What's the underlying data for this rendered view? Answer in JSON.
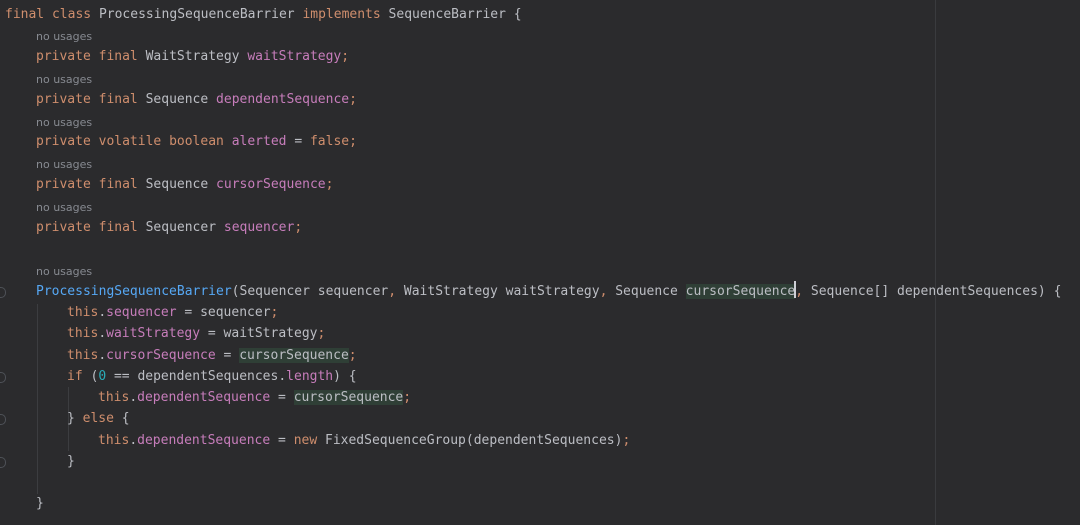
{
  "editor": {
    "colors": {
      "background": "#2b2b2d",
      "keyword": "#cf8e6d",
      "field": "#c77dbb",
      "method": "#56a8f5",
      "number": "#2aacb8",
      "text": "#bcbec4",
      "hint": "#878a91",
      "highlight": "#2f3f36"
    },
    "usage_hint": "no usages",
    "lines": {
      "class_decl": {
        "kw1": "final",
        "kw2": "class",
        "name": "ProcessingSequenceBarrier",
        "kw3": "implements",
        "iface": "SequenceBarrier",
        "brace": "{"
      },
      "field1": {
        "kw1": "private",
        "kw2": "final",
        "type": "WaitStrategy",
        "name": "waitStrategy"
      },
      "field2": {
        "kw1": "private",
        "kw2": "final",
        "type": "Sequence",
        "name": "dependentSequence"
      },
      "field3": {
        "kw1": "private",
        "kw2": "volatile",
        "kw3": "boolean",
        "name": "alerted",
        "op": "=",
        "value": "false"
      },
      "field4": {
        "kw1": "private",
        "kw2": "final",
        "type": "Sequence",
        "name": "cursorSequence"
      },
      "field5": {
        "kw1": "private",
        "kw2": "final",
        "type": "Sequencer",
        "name": "sequencer"
      },
      "ctor": {
        "name": "ProcessingSequenceBarrier",
        "p1_type": "Sequencer",
        "p1_name": "sequencer",
        "p2_type": "WaitStrategy",
        "p2_name": "waitStrategy",
        "p3_type": "Sequence",
        "p3_name": "cursorSequence",
        "p4_type": "Sequence[]",
        "p4_name": "dependentSequences",
        "brace": "{"
      },
      "stmt1": {
        "this": "this",
        "field": "sequencer",
        "op": "=",
        "value": "sequencer"
      },
      "stmt2": {
        "this": "this",
        "field": "waitStrategy",
        "op": "=",
        "value": "waitStrategy"
      },
      "stmt3": {
        "this": "this",
        "field": "cursorSequence",
        "op": "=",
        "value": "cursorSequence"
      },
      "if_stmt": {
        "kw": "if",
        "num": "0",
        "op": "==",
        "obj": "dependentSequences",
        "prop": "length",
        "brace": "{"
      },
      "stmt4": {
        "this": "this",
        "field": "dependentSequence",
        "op": "=",
        "value": "cursorSequence"
      },
      "else_stmt": {
        "kw": "else"
      },
      "stmt5": {
        "this": "this",
        "field": "dependentSequence",
        "op": "=",
        "kw": "new",
        "cls": "FixedSequenceGroup",
        "arg": "dependentSequences"
      },
      "close_if": "}",
      "close_ctor": "}"
    }
  }
}
